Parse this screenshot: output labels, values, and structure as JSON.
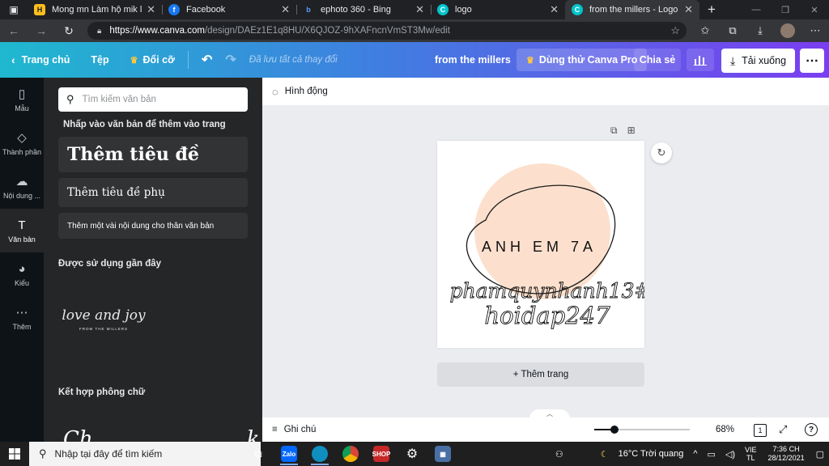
{
  "browser": {
    "tabs": [
      {
        "title": "Mong mn Làm hộ mik logo Ả",
        "favicon": "H",
        "favicon_color": "#fcbf1e",
        "active": false
      },
      {
        "title": "Facebook",
        "favicon": "f",
        "favicon_color": "#1877f2",
        "active": false
      },
      {
        "title": "ephoto 360 - Bing",
        "favicon": "b",
        "favicon_color": "#2b6cd4",
        "active": false
      },
      {
        "title": "logo",
        "favicon": "C",
        "favicon_color": "#00c4cc",
        "active": false
      },
      {
        "title": "from the millers - Logo",
        "favicon": "C",
        "favicon_color": "#00c4cc",
        "active": true
      }
    ],
    "url_host": "https://www.canva.com",
    "url_path": "/design/DAEz1E1q8HU/X6QJOZ-9hXAFncnVmST3Mw/edit"
  },
  "header": {
    "home": "Trang chủ",
    "file": "Tệp",
    "resize": "Đổi cỡ",
    "saved": "Đã lưu tất cả thay đổi",
    "design_title": "from the millers",
    "try_pro": "Dùng thử Canva Pro",
    "share": "Chia sẻ",
    "download": "Tải xuống"
  },
  "rail": [
    {
      "label": "Mẫu",
      "icon": "layout-icon",
      "glyph": "▯"
    },
    {
      "label": "Thành phần",
      "icon": "shapes-icon",
      "glyph": "◇"
    },
    {
      "label": "Nội dung ...",
      "icon": "upload-icon",
      "glyph": "☁"
    },
    {
      "label": "Văn bản",
      "icon": "text-icon",
      "glyph": "T",
      "active": true
    },
    {
      "label": "Kiểu",
      "icon": "palette-icon",
      "glyph": "◕"
    },
    {
      "label": "Thêm",
      "icon": "more-icon",
      "glyph": "⋯"
    }
  ],
  "panel": {
    "search_placeholder": "Tìm kiếm văn bản",
    "hint": "Nhấp vào văn bản để thêm vào trang",
    "add_heading": "Thêm tiêu đề",
    "add_subheading": "Thêm tiêu đề phụ",
    "add_body": "Thêm một vài nội dung cho thân văn bản",
    "recent_title": "Được sử dụng gần đây",
    "recent_script": "love and joy",
    "recent_small": "FROM THE MILLERS",
    "combos_title": "Kết hợp phông chữ"
  },
  "editor": {
    "animate": "Hình động",
    "design": {
      "main_text": "ANH EM 7A",
      "script_line1": "phamquynhanh13#",
      "script_line2": "hoidap247",
      "blob_color": "#fce0cd"
    },
    "add_page": "+ Thêm trang",
    "notes": "Ghi chú",
    "zoom_label": "68%",
    "zoom_fraction": 0.21,
    "page_count": "1"
  },
  "taskbar": {
    "search_placeholder": "Nhập tại đây để tìm kiếm",
    "weather": "16°C Trời quang",
    "lang_top": "VIE",
    "lang_bottom": "TL",
    "time": "7:36 CH",
    "date": "28/12/2021"
  }
}
